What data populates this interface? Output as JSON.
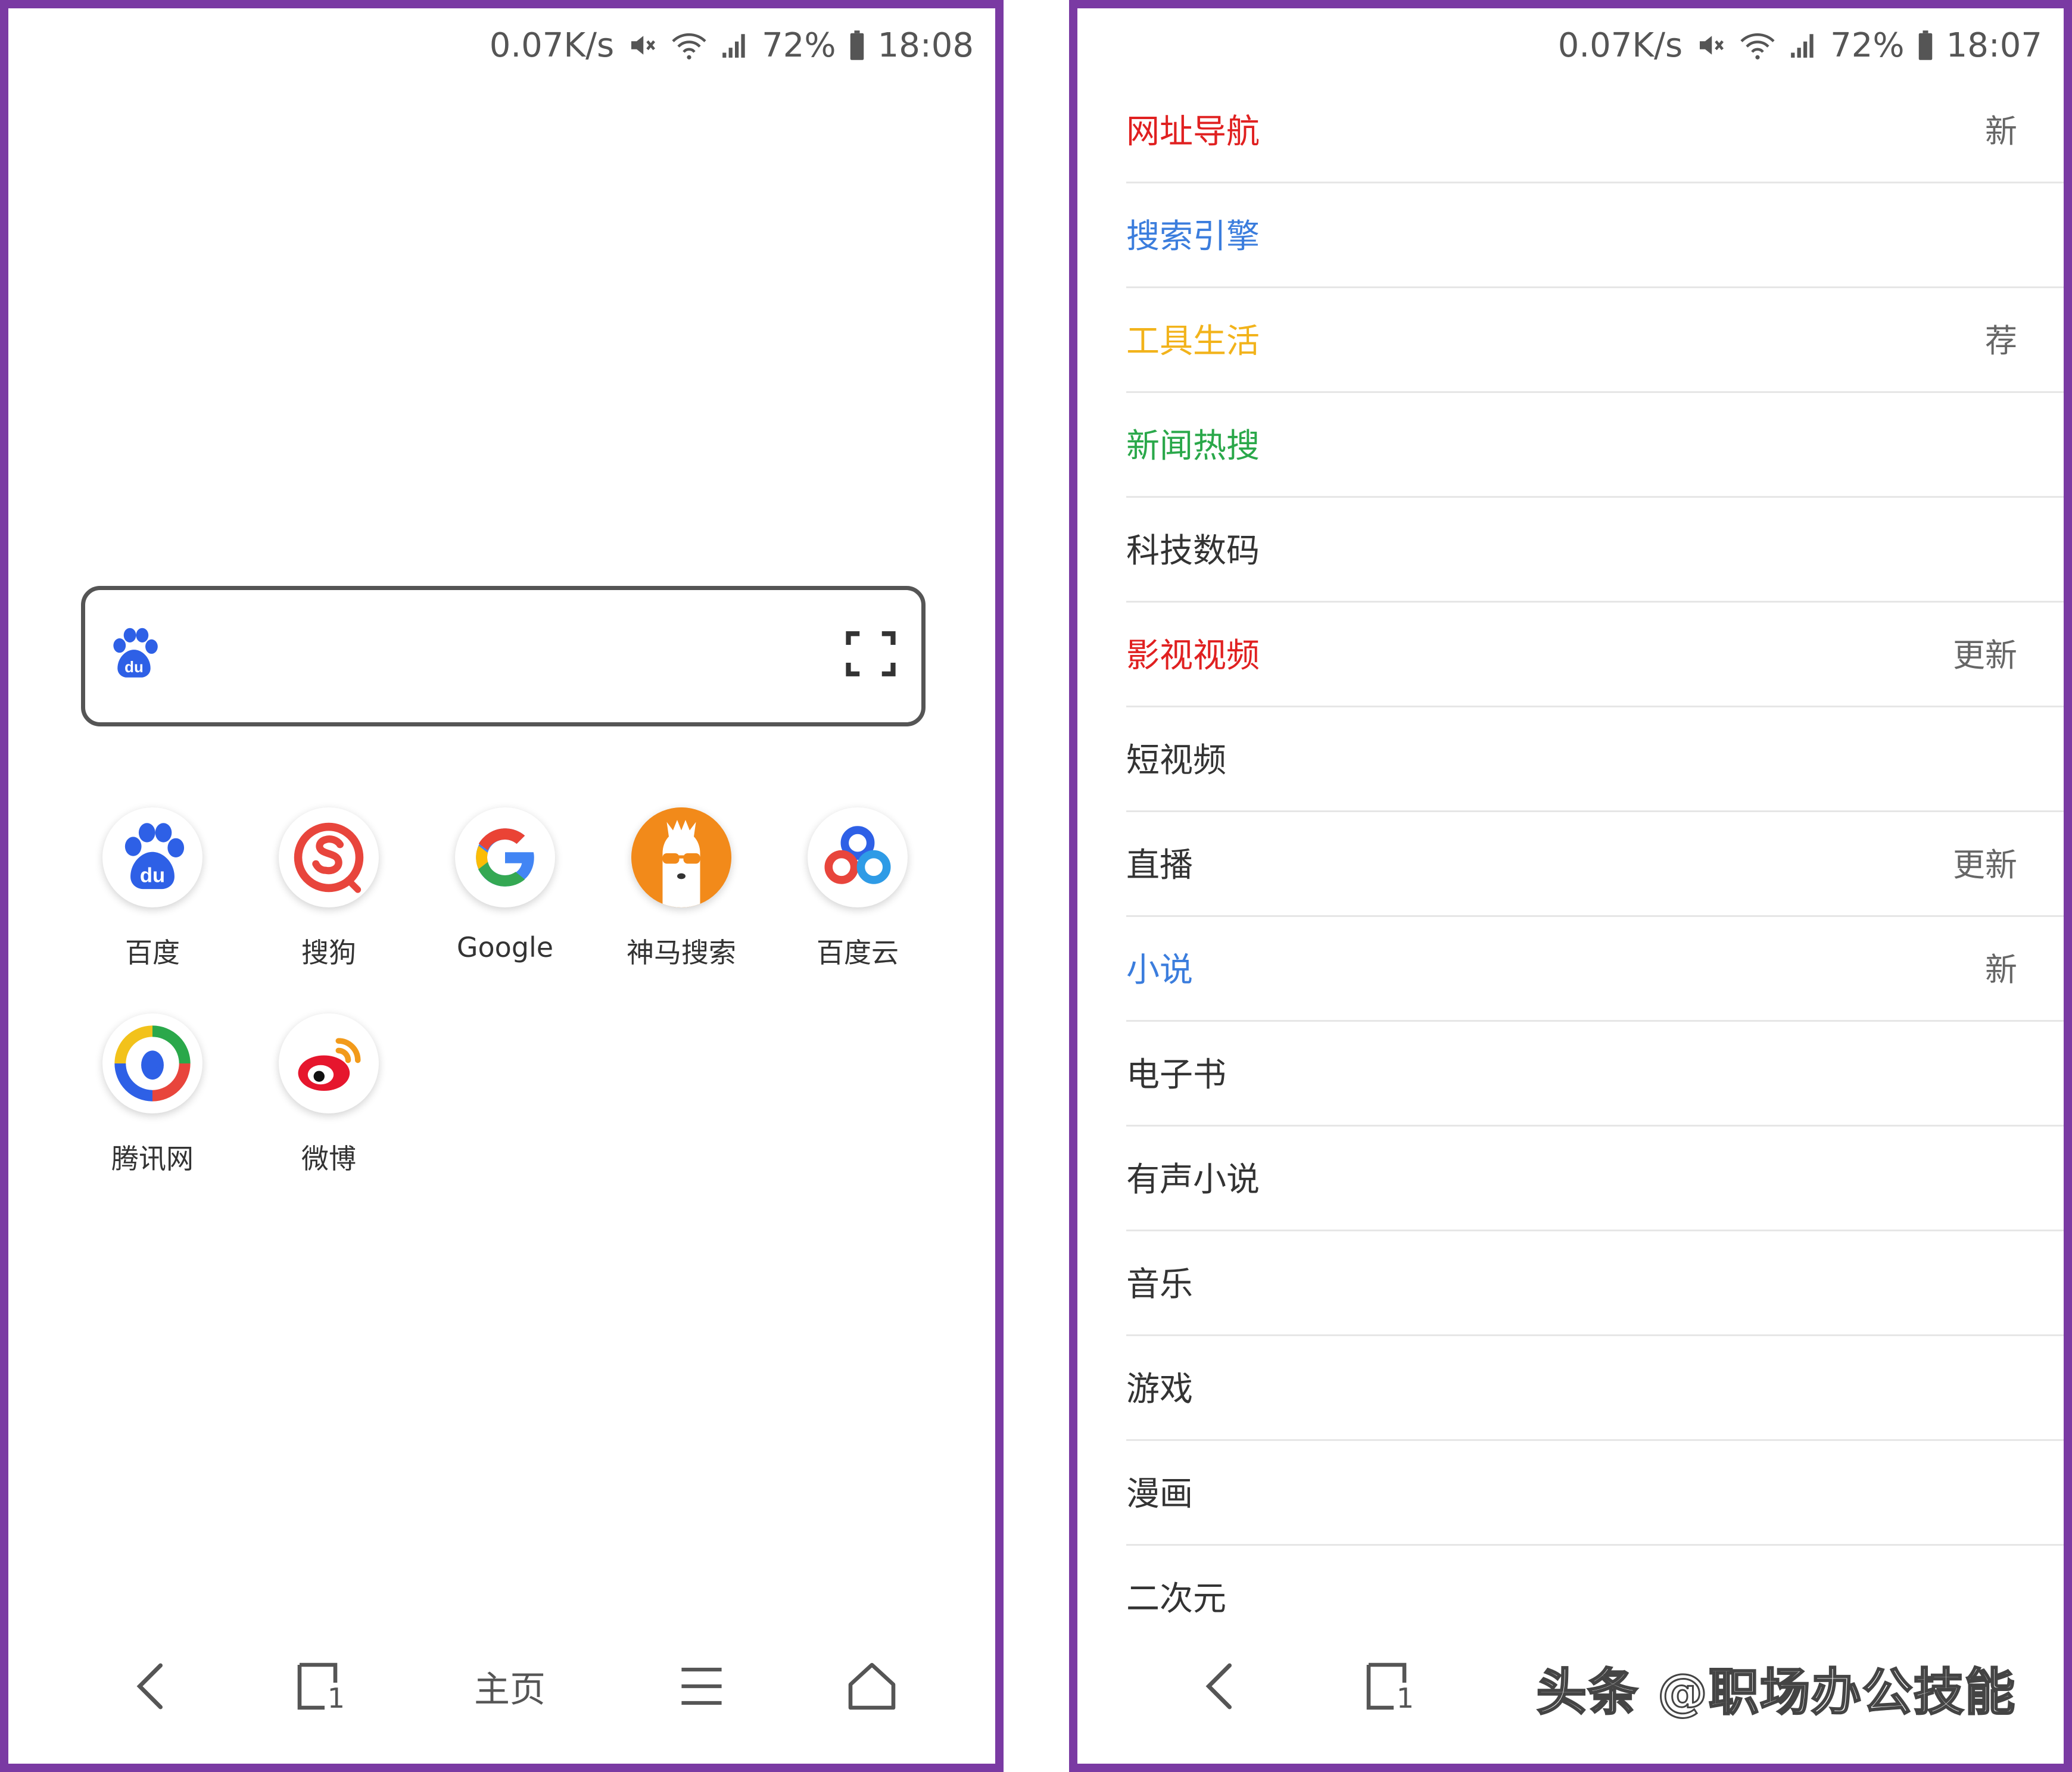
{
  "left_screen": {
    "status": {
      "speed": "0.07K/s",
      "battery": "72%",
      "time": "18:08"
    },
    "search": {
      "engine_icon": "baidu-paw-icon",
      "scan_icon": "scan-icon"
    },
    "shortcuts": [
      {
        "label": "百度",
        "icon": "baidu-icon"
      },
      {
        "label": "搜狗",
        "icon": "sogou-icon"
      },
      {
        "label": "Google",
        "icon": "google-icon"
      },
      {
        "label": "神马搜索",
        "icon": "shenma-icon"
      },
      {
        "label": "百度云",
        "icon": "baidu-cloud-icon"
      },
      {
        "label": "腾讯网",
        "icon": "tencent-icon"
      },
      {
        "label": "微博",
        "icon": "weibo-icon"
      }
    ],
    "bottom_nav": {
      "home_label": "主页",
      "tab_count": "1"
    }
  },
  "right_screen": {
    "status": {
      "speed": "0.07K/s",
      "battery": "72%",
      "time": "18:07"
    },
    "categories": [
      {
        "name": "网址导航",
        "color": "#e02020",
        "tag": "新"
      },
      {
        "name": "搜索引擎",
        "color": "#3b7ddd",
        "tag": ""
      },
      {
        "name": "工具生活",
        "color": "#f2b31b",
        "tag": "荐"
      },
      {
        "name": "新闻热搜",
        "color": "#2aa84a",
        "tag": ""
      },
      {
        "name": "科技数码",
        "color": "#333333",
        "tag": ""
      },
      {
        "name": "影视视频",
        "color": "#e02020",
        "tag": "更新"
      },
      {
        "name": "短视频",
        "color": "#333333",
        "tag": ""
      },
      {
        "name": "直播",
        "color": "#333333",
        "tag": "更新"
      },
      {
        "name": "小说",
        "color": "#3b7ddd",
        "tag": "新"
      },
      {
        "name": "电子书",
        "color": "#333333",
        "tag": ""
      },
      {
        "name": "有声小说",
        "color": "#333333",
        "tag": ""
      },
      {
        "name": "音乐",
        "color": "#333333",
        "tag": ""
      },
      {
        "name": "游戏",
        "color": "#333333",
        "tag": ""
      },
      {
        "name": "漫画",
        "color": "#333333",
        "tag": ""
      },
      {
        "name": "二次元",
        "color": "#333333",
        "tag": ""
      }
    ],
    "bottom_nav": {
      "tab_count": "1"
    },
    "watermark": "头条 @职场办公技能"
  },
  "colors": {
    "frame": "#7a3aa3",
    "baidu_blue": "#2e60e6"
  }
}
